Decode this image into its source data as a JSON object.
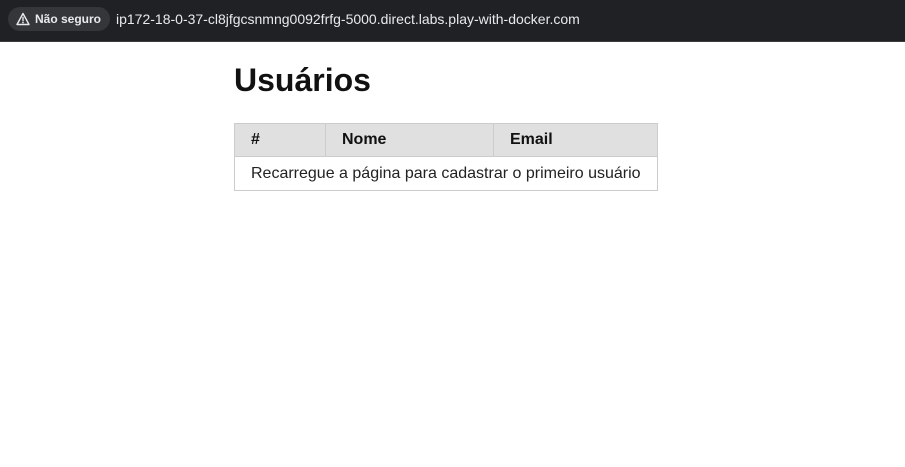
{
  "browser": {
    "security_label": "Não seguro",
    "security_icon": "warning-triangle-icon",
    "url": "ip172-18-0-37-cl8jfgcsnmng0092frfg-5000.direct.labs.play-with-docker.com"
  },
  "page": {
    "title": "Usuários",
    "table": {
      "columns": [
        "#",
        "Nome",
        "Email"
      ],
      "empty_message": "Recarregue a página para cadastrar o primeiro usuário"
    }
  },
  "colors": {
    "browser_bar": "#202124",
    "chip_bg": "#35363a",
    "table_header_bg": "#e0e0e0",
    "table_border": "#cccccc"
  }
}
